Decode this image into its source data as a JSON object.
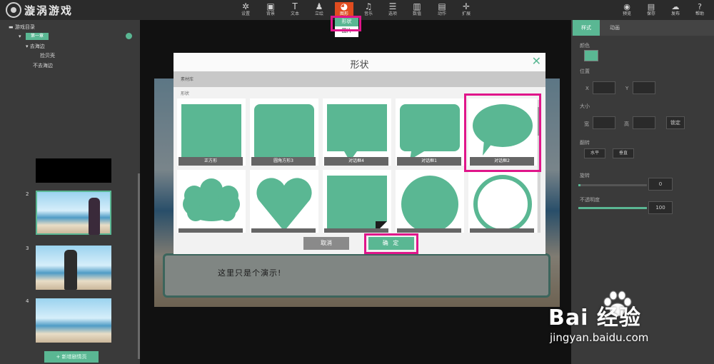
{
  "app": {
    "logo_text": "漩涡游戏"
  },
  "toolbar": {
    "items": [
      {
        "label": "设置",
        "icon": "gear-icon",
        "glyph": "✲"
      },
      {
        "label": "背景",
        "icon": "image-icon",
        "glyph": "▣"
      },
      {
        "label": "文本",
        "icon": "text-icon",
        "glyph": "T"
      },
      {
        "label": "立绘",
        "icon": "person-icon",
        "glyph": "♟"
      },
      {
        "label": "图形",
        "icon": "shape-icon",
        "glyph": "◕"
      },
      {
        "label": "音乐",
        "icon": "music-icon",
        "glyph": "♫"
      },
      {
        "label": "选项",
        "icon": "options-icon",
        "glyph": "☰"
      },
      {
        "label": "数值",
        "icon": "chart-icon",
        "glyph": "▥"
      },
      {
        "label": "动作",
        "icon": "film-icon",
        "glyph": "▤"
      },
      {
        "label": "扩展",
        "icon": "plus-icon",
        "glyph": "✛"
      }
    ],
    "right_items": [
      {
        "label": "预览",
        "icon": "eye-icon",
        "glyph": "◉"
      },
      {
        "label": "保存",
        "icon": "save-icon",
        "glyph": "▤"
      },
      {
        "label": "发布",
        "icon": "upload-icon",
        "glyph": "☁"
      },
      {
        "label": "帮助",
        "icon": "help-icon",
        "glyph": "?"
      }
    ]
  },
  "dropdown": {
    "items": [
      "形状",
      "图片"
    ]
  },
  "left_panel": {
    "tree_root": "游戏目录",
    "tree_selected": "第一章",
    "tree_child": "去海边",
    "tree_grandchild": "捡贝壳",
    "tree_child2": "不去海边",
    "slide_numbers": [
      "2",
      "3",
      "4"
    ],
    "add_button": "+ 新增剧情页"
  },
  "stage": {
    "dialog_text": "这里只是个演示!"
  },
  "right_panel": {
    "tabs": [
      "样式",
      "动画"
    ],
    "color_label": "颜色",
    "position_label": "位置",
    "x_label": "X",
    "y_label": "Y",
    "size_label": "大小",
    "w_label": "宽",
    "h_label": "高",
    "lock_button": "锁定",
    "flip_label": "翻转",
    "flip_h": "水平",
    "flip_v": "垂直",
    "rotate_label": "旋转",
    "rotate_value": "0",
    "opacity_label": "不透明度",
    "opacity_value": "100",
    "colors": {
      "accent": "#5ab793"
    }
  },
  "modal": {
    "title": "形状",
    "close": "✕",
    "section_bar": "素材库",
    "section_label": "形状",
    "shapes": [
      "正方形",
      "圆角方形3",
      "对话框4",
      "对话框1",
      "对话框2",
      "",
      "",
      "",
      "",
      ""
    ],
    "cancel": "取消",
    "ok": "确 定",
    "selected_index": 4
  },
  "watermark": {
    "brand": "Bai  经验",
    "url": "jingyan.baidu.com"
  }
}
